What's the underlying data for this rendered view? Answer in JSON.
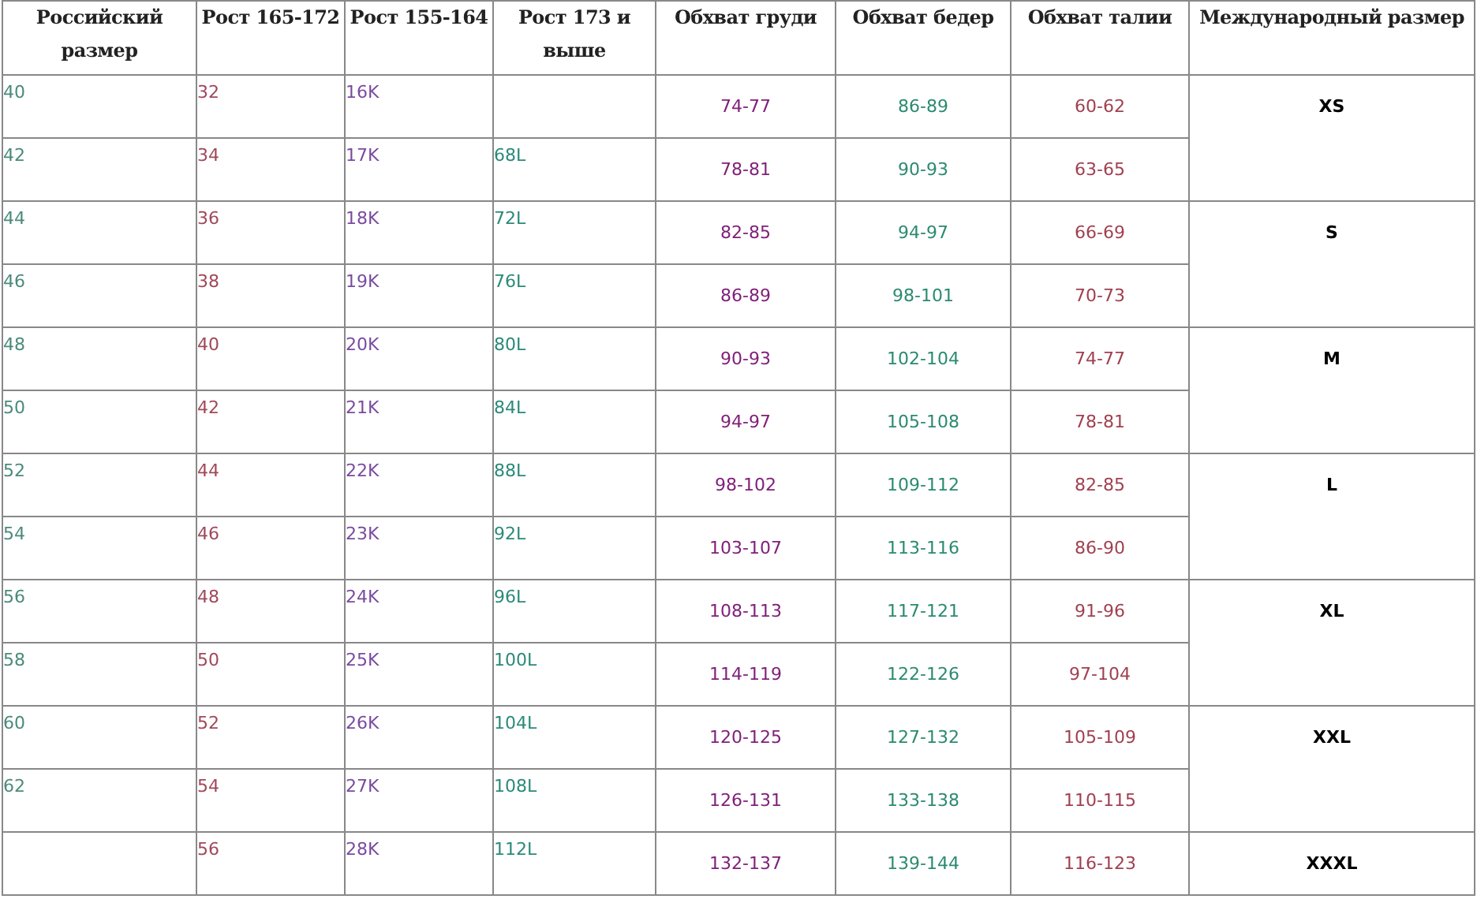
{
  "table": {
    "columns": [
      "Российский размер",
      "Рост 165-172",
      "Рост 155-164",
      "Рост 173 и выше",
      "Обхват груди",
      "Обхват бедер",
      "Обхват талии",
      "Международный размер"
    ],
    "rows": [
      {
        "cells": [
          "40",
          "32",
          "16K",
          null,
          "74-77",
          "86-89",
          "60-62"
        ],
        "international": "XS"
      },
      {
        "cells": [
          "42",
          "34",
          "17K",
          "68L",
          "78-81",
          "90-93",
          "63-65"
        ]
      },
      {
        "cells": [
          "44",
          "36",
          "18K",
          "72L",
          "82-85",
          "94-97",
          "66-69"
        ],
        "international": "S"
      },
      {
        "cells": [
          "46",
          "38",
          "19K",
          "76L",
          "86-89",
          "98-101",
          "70-73"
        ]
      },
      {
        "cells": [
          "48",
          "40",
          "20K",
          "80L",
          "90-93",
          "102-104",
          "74-77"
        ],
        "international": "M"
      },
      {
        "cells": [
          "50",
          "42",
          "21K",
          "84L",
          "94-97",
          "105-108",
          "78-81"
        ]
      },
      {
        "cells": [
          "52",
          "44",
          "22K",
          "88L",
          "98-102",
          "109-112",
          "82-85"
        ],
        "international": "L"
      },
      {
        "cells": [
          "54",
          "46",
          "23K",
          "92L",
          "103-107",
          "113-116",
          "86-90"
        ]
      },
      {
        "cells": [
          "56",
          "48",
          "24K",
          "96L",
          "108-113",
          "117-121",
          "91-96"
        ],
        "international": "XL"
      },
      {
        "cells": [
          "58",
          "50",
          "25K",
          "100L",
          "114-119",
          "122-126",
          "97-104"
        ]
      },
      {
        "cells": [
          "60",
          "52",
          "26K",
          "104L",
          "120-125",
          "127-132",
          "105-109"
        ],
        "international": "XXL"
      },
      {
        "cells": [
          "62",
          "54",
          "27K",
          "108L",
          "126-131",
          "133-138",
          "110-115"
        ]
      },
      {
        "cells": [
          null,
          "56",
          "28K",
          "112L",
          "132-137",
          "139-144",
          "116-123"
        ],
        "international": "XXXL"
      }
    ]
  }
}
